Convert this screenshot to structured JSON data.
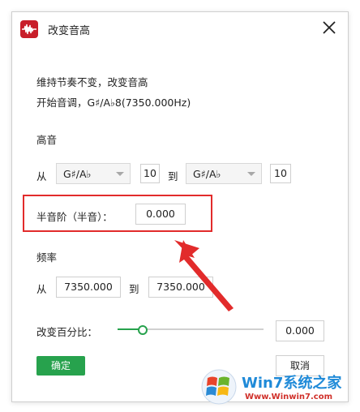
{
  "window": {
    "title": "改变音高"
  },
  "description": {
    "line1": "维持节奏不变，改变音高",
    "line2": "开始音调，G♯/A♭8(7350.000Hz)"
  },
  "pitch": {
    "section_label": "高音",
    "from_label": "从",
    "to_label": "到",
    "from_note": "G♯/A♭",
    "from_octave": "10",
    "to_note": "G♯/A♭",
    "to_octave": "10"
  },
  "semitone": {
    "label": "半音阶（半音）：",
    "value": "0.000"
  },
  "frequency": {
    "section_label": "频率",
    "from_label": "从",
    "to_label": "到",
    "from_value": "7350.000",
    "to_value": "7350.000"
  },
  "percent": {
    "label": "改变百分比：",
    "value": "0.000",
    "slider_fraction": 0.17
  },
  "buttons": {
    "ok": "确定",
    "cancel": "取消"
  },
  "watermark": {
    "brand": "Win7系统之家",
    "url": "Www.Winwin7.com"
  },
  "colors": {
    "accent": "#27a24d",
    "highlight": "#e22b2b",
    "app_icon": "#c81e2a"
  },
  "icons": {
    "app": "audio-wave-icon",
    "close": "close-icon",
    "dropdown": "chevron-down-icon"
  }
}
